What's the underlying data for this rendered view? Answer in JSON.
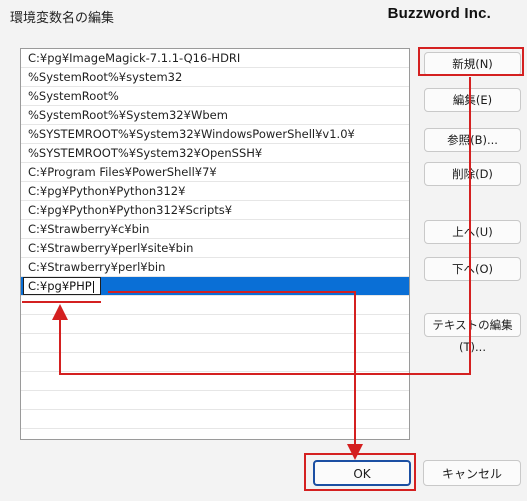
{
  "dialog": {
    "title": "環境変数名の編集",
    "brand": "Buzzword Inc."
  },
  "paths": [
    "C:¥pg¥ImageMagick-7.1.1-Q16-HDRI",
    "%SystemRoot%¥system32",
    "%SystemRoot%",
    "%SystemRoot%¥System32¥Wbem",
    "%SYSTEMROOT%¥System32¥WindowsPowerShell¥v1.0¥",
    "%SYSTEMROOT%¥System32¥OpenSSH¥",
    "C:¥Program Files¥PowerShell¥7¥",
    "C:¥pg¥Python¥Python312¥",
    "C:¥pg¥Python¥Python312¥Scripts¥",
    "C:¥Strawberry¥c¥bin",
    "C:¥Strawberry¥perl¥site¥bin",
    "C:¥Strawberry¥perl¥bin"
  ],
  "editing_value": "C:¥pg¥PHP",
  "buttons": {
    "new": "新規(N)",
    "edit": "編集(E)",
    "browse": "参照(B)...",
    "delete": "削除(D)",
    "up": "上へ(U)",
    "down": "下へ(O)",
    "edit_text": "テキストの編集(T)...",
    "ok": "OK",
    "cancel": "キャンセル"
  },
  "colors": {
    "selection": "#0a6fd6",
    "highlight": "#d42020"
  }
}
